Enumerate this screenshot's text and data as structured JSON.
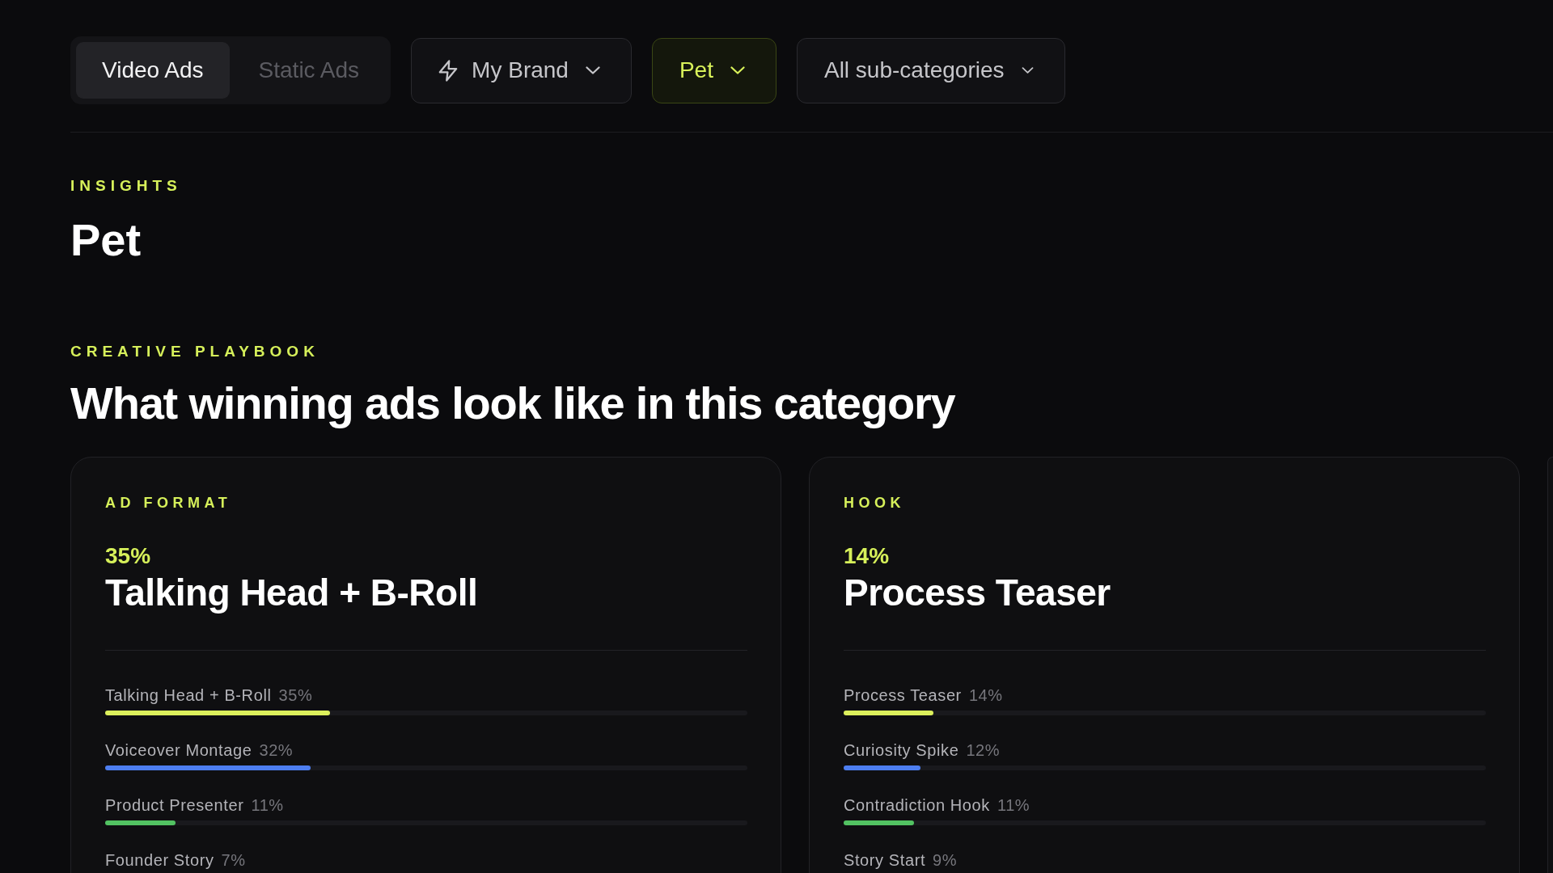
{
  "top_bar": {
    "ad_type_tabs": [
      {
        "label": "Video Ads",
        "selected": true
      },
      {
        "label": "Static Ads",
        "selected": false
      }
    ],
    "brand_dropdown": {
      "label": "My Brand",
      "active": false
    },
    "category_dropdown": {
      "label": "Pet",
      "active": true
    },
    "subcategory_dropdown": {
      "label": "All sub-categories",
      "active": false
    }
  },
  "insights": {
    "eyebrow": "INSIGHTS",
    "title": "Pet"
  },
  "playbook": {
    "eyebrow": "CREATIVE PLAYBOOK",
    "title": "What winning ads look like in this category",
    "cards": [
      {
        "label": "AD FORMAT",
        "top_share": "35%",
        "top_name": "Talking Head + B-Roll",
        "rows": [
          {
            "name": "Talking Head + B-Roll",
            "share": "35%",
            "level": 0.35,
            "color": "#dcf05c"
          },
          {
            "name": "Voiceover Montage",
            "share": "32%",
            "level": 0.32,
            "color": "#4d7ef0"
          },
          {
            "name": "Product Presenter",
            "share": "11%",
            "level": 0.11,
            "color": "#52c262"
          },
          {
            "name": "Founder Story",
            "share": "7%"
          }
        ]
      },
      {
        "label": "HOOK",
        "top_share": "14%",
        "top_name": "Process Teaser",
        "rows": [
          {
            "name": "Process Teaser",
            "share": "14%",
            "level": 0.14,
            "color": "#dcf05c"
          },
          {
            "name": "Curiosity Spike",
            "share": "12%",
            "level": 0.12,
            "color": "#4d7ef0"
          },
          {
            "name": "Contradiction Hook",
            "share": "11%",
            "level": 0.11,
            "color": "#52c262"
          },
          {
            "name": "Story Start",
            "share": "9%"
          }
        ]
      }
    ]
  }
}
